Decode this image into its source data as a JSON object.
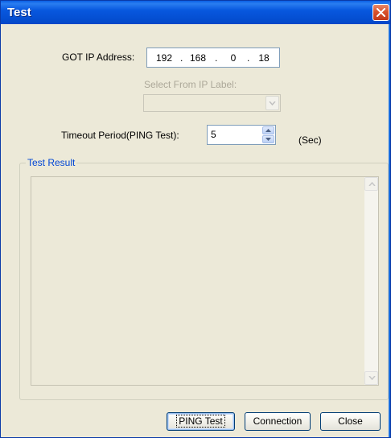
{
  "window": {
    "title": "Test"
  },
  "icons": {
    "close": "close-icon",
    "combo_arrow": "chevron-down-icon",
    "spin_up": "up-arrow-icon",
    "spin_down": "down-arrow-icon",
    "scroll_up": "scroll-up-icon",
    "scroll_down": "scroll-down-icon"
  },
  "got_ip": {
    "label": "GOT IP Address:",
    "octets": [
      "192",
      "168",
      "0",
      "18"
    ],
    "separator": "."
  },
  "ip_label": {
    "label": "Select From IP Label:",
    "value": ""
  },
  "timeout": {
    "label": "Timeout Period(PING Test):",
    "value": "5",
    "unit": "(Sec)"
  },
  "test_result": {
    "legend": "Test Result",
    "content": ""
  },
  "buttons": {
    "ping": "PING Test",
    "connection": "Connection",
    "close": "Close"
  },
  "colors": {
    "titlebar": "#0550d4",
    "legend": "#0046d5",
    "dialog_bg": "#ece9d8",
    "disabled_text": "#aca899"
  }
}
